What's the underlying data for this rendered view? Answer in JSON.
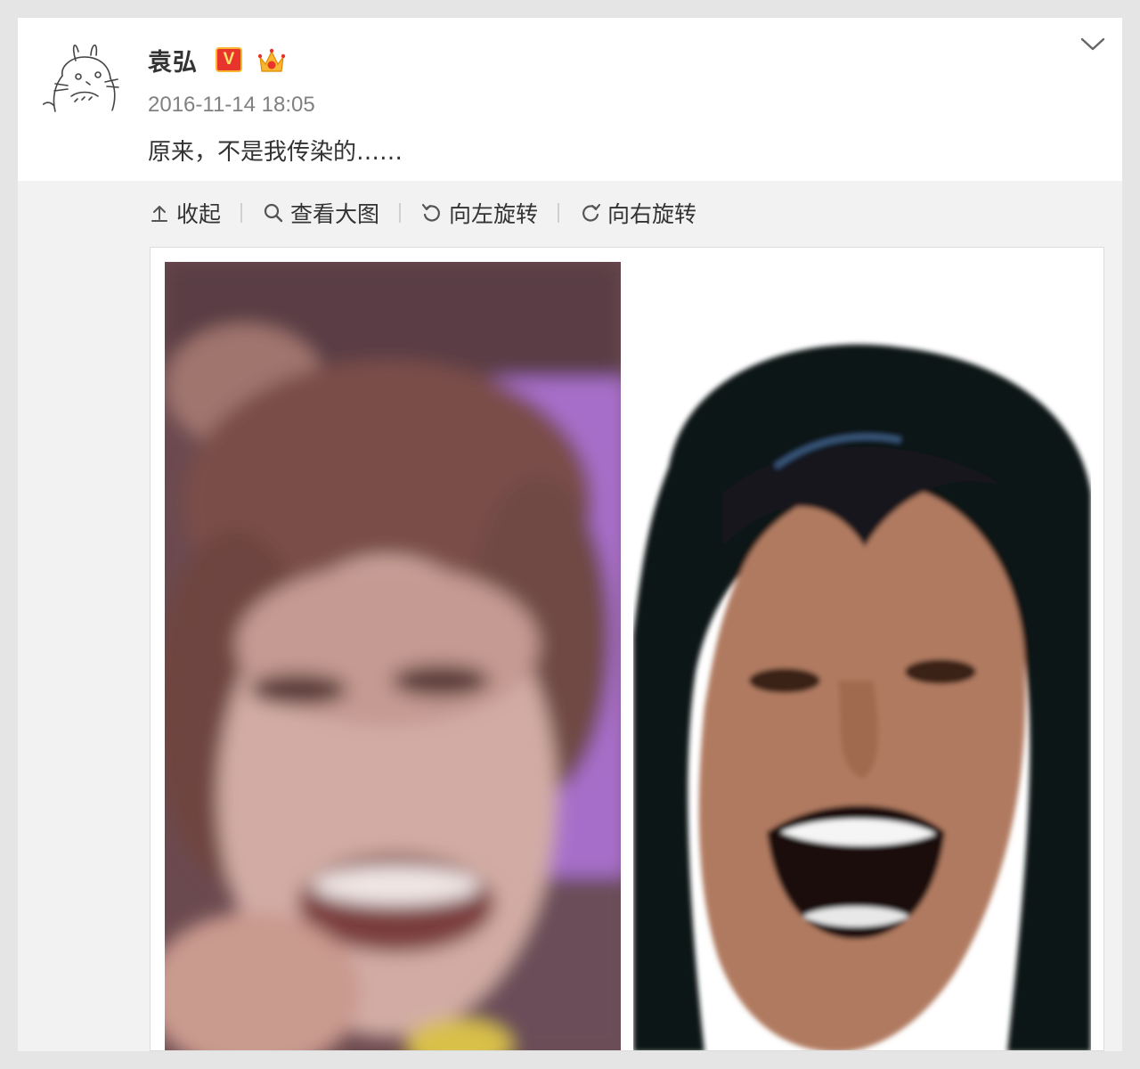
{
  "post": {
    "username": "袁弘",
    "vip_badge_text": "V",
    "timestamp": "2016-11-14 18:05",
    "text": "原来，不是我传染的……",
    "avatar_icon": "totoro-sketch-icon",
    "menu_icon": "chevron-down-icon"
  },
  "toolbar": {
    "collapse_label": "收起",
    "view_large_label": "查看大图",
    "rotate_left_label": "向左旋转",
    "rotate_right_label": "向右旋转"
  },
  "colors": {
    "vip_badge": "#e8342c",
    "text_primary": "#333333",
    "text_secondary": "#808080",
    "media_background": "#f2f2f2"
  }
}
